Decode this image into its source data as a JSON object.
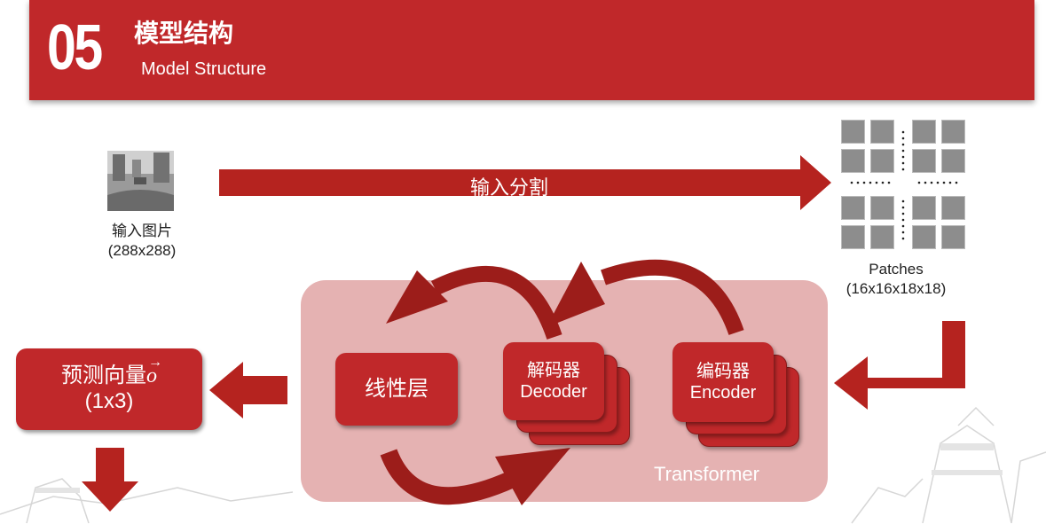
{
  "header": {
    "number": "05",
    "title_cn": "模型结构",
    "title_en": "Model Structure"
  },
  "input_image": {
    "label_cn": "输入图片",
    "label_size": "(288x288)"
  },
  "split_arrow": {
    "label": "输入分割"
  },
  "patches": {
    "label": "Patches",
    "label_size": "(16x16x18x18)"
  },
  "transformer": {
    "label": "Transformer",
    "encoder": {
      "label_cn": "编码器",
      "label_en": "Encoder"
    },
    "decoder": {
      "label_cn": "解码器",
      "label_en": "Decoder"
    },
    "linear": {
      "label_cn": "线性层"
    }
  },
  "output": {
    "label_cn": "预测向量",
    "vector_symbol": "o",
    "label_size": "(1x3)"
  },
  "colors": {
    "brand_red": "#c0282a",
    "arrow_red": "#b5231f",
    "container": "rgba(192,72,72,0.42)"
  }
}
